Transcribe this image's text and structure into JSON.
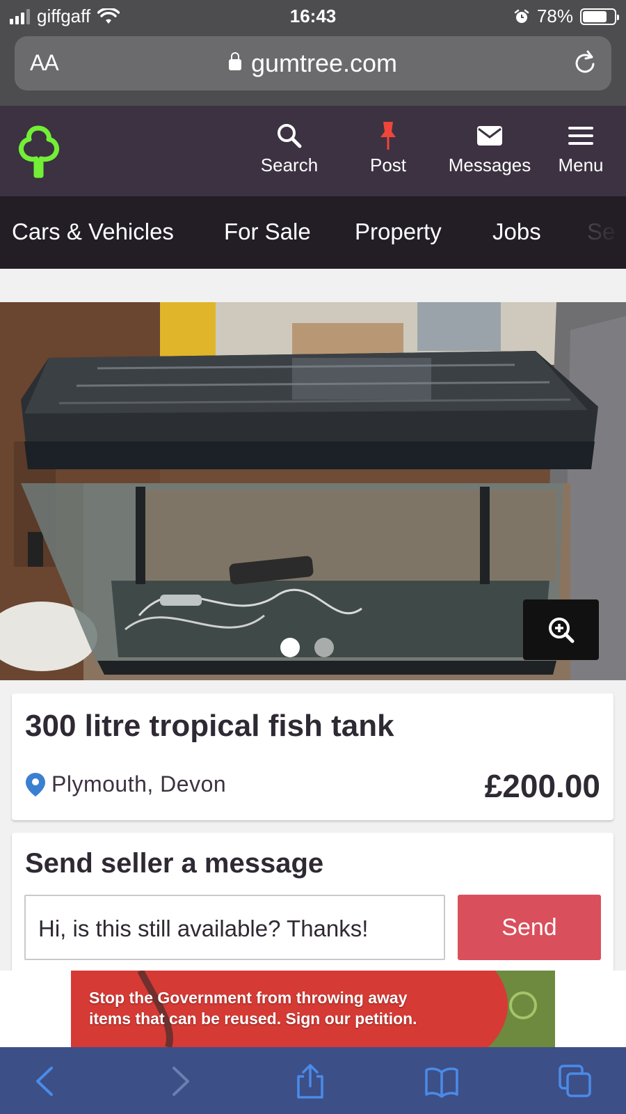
{
  "status_bar": {
    "carrier": "giffgaff",
    "time": "16:43",
    "battery_percent": "78%",
    "battery_level": 0.78,
    "icons": [
      "signal-icon",
      "wifi-icon",
      "alarm-icon",
      "battery-icon"
    ]
  },
  "browser": {
    "text_size_label": "AA",
    "url": "gumtree.com",
    "icons": [
      "lock-icon",
      "reload-icon"
    ]
  },
  "header": {
    "logo": "gumtree-logo",
    "nav": [
      {
        "label": "Search",
        "icon": "search-icon"
      },
      {
        "label": "Post",
        "icon": "pin-icon"
      },
      {
        "label": "Messages",
        "icon": "envelope-icon"
      },
      {
        "label": "Menu",
        "icon": "hamburger-icon"
      }
    ]
  },
  "categories": [
    "Cars & Vehicles",
    "For Sale",
    "Property",
    "Jobs",
    "Se"
  ],
  "gallery": {
    "image_count": 2,
    "active_index": 0,
    "zoom_icon": "zoom-in-icon"
  },
  "listing": {
    "title": "300 litre tropical fish tank",
    "location": "Plymouth, Devon",
    "price": "£200.00",
    "location_icon": "map-pin-icon"
  },
  "message": {
    "heading": "Send seller a message",
    "input_value": "Hi, is this still available? Thanks!",
    "send_label": "Send"
  },
  "ad": {
    "text_line1": "Stop the Government from throwing away",
    "text_line2": "items that can be reused. Sign our petition."
  },
  "toolbar": {
    "icons": [
      "back-icon",
      "forward-icon",
      "share-icon",
      "bookmarks-icon",
      "tabs-icon"
    ]
  },
  "colors": {
    "header_bg": "#3c3241",
    "category_bg": "#231d26",
    "brand_green": "#72ef36",
    "post_red": "#f0453a",
    "send_button": "#d94f5c",
    "location_pin": "#3b7fd1",
    "toolbar_bg": "#3d4f87",
    "toolbar_icons": "#4a8be8"
  }
}
